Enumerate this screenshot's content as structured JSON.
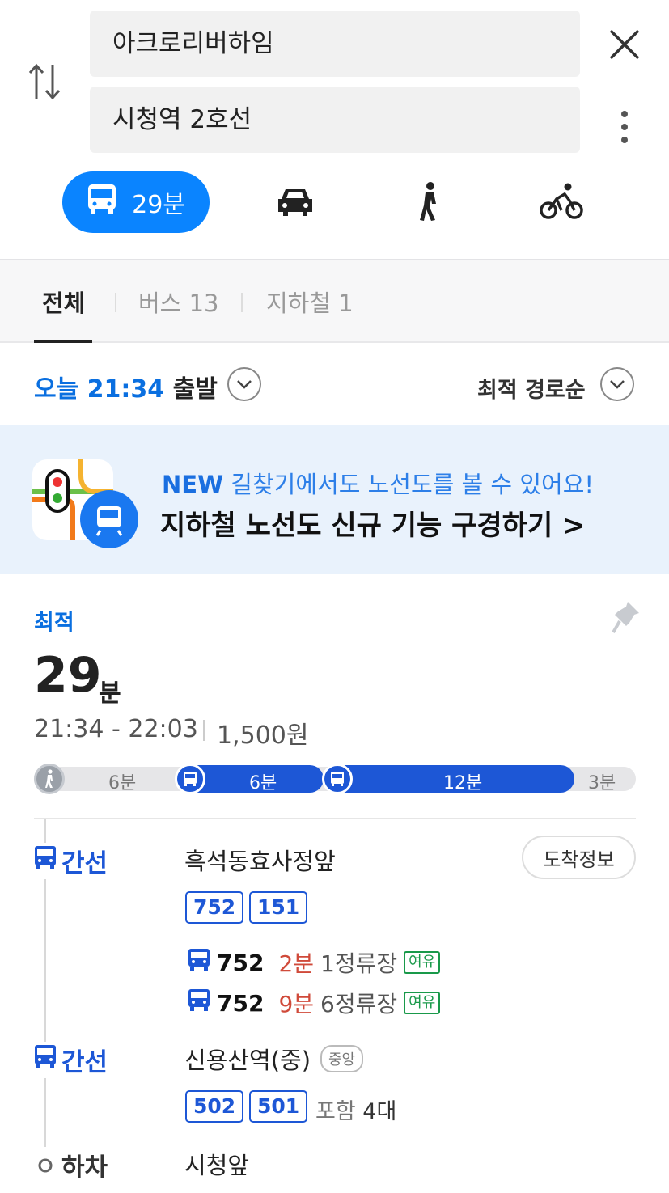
{
  "search": {
    "origin": "아크로리버하임",
    "destination": "시청역 2호선"
  },
  "modes": {
    "transit_time": "29분"
  },
  "tabs": [
    {
      "label": "전체"
    },
    {
      "label": "버스 13"
    },
    {
      "label": "지하철 1"
    }
  ],
  "depart": {
    "today_time": "오늘 21:34",
    "suffix": "출발",
    "sort": "최적 경로순"
  },
  "banner": {
    "new": "NEW",
    "line1": "길찾기에서도 노선도를 볼 수 있어요!",
    "line2": "지하철 노선도 신규 기능 구경하기 >"
  },
  "route": {
    "label": "최적",
    "minutes": "29",
    "minutes_unit": "분",
    "time_range": "21:34 - 22:03",
    "fare": "1,500원",
    "segments": [
      {
        "mode": "walk",
        "label": "6분"
      },
      {
        "mode": "bus",
        "label": "6분"
      },
      {
        "mode": "bus",
        "label": "12분"
      },
      {
        "mode": "walk",
        "label": "3분"
      }
    ],
    "legs": [
      {
        "type_label": "간선",
        "stop": "흑석동효사정앞",
        "action": "도착정보",
        "chips": [
          "752",
          "151"
        ],
        "arrivals": [
          {
            "bus": "752",
            "min": "2분",
            "stops": "1정류장",
            "status": "여유"
          },
          {
            "bus": "752",
            "min": "9분",
            "stops": "6정류장",
            "status": "여유"
          }
        ]
      },
      {
        "type_label": "간선",
        "stop": "신용산역(중)",
        "tag": "중앙",
        "chips": [
          "502",
          "501"
        ],
        "include_prefix": "포함",
        "include_count": "4대"
      }
    ],
    "get_off": {
      "label": "하차",
      "stop": "시청앞"
    }
  },
  "colors": {
    "accent": "#0a84ff",
    "bus_blue": "#1d57d6",
    "red": "#d04a3a",
    "green": "#19994a"
  }
}
